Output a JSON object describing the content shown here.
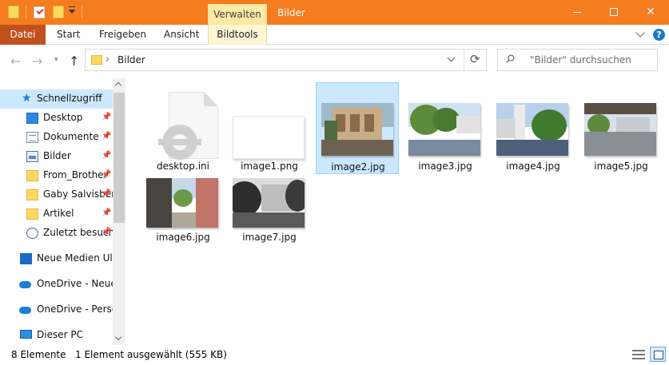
{
  "titlebar": {
    "contextual_tab": "Verwalten",
    "window_title": "Bilder",
    "accent": "#f57c1f"
  },
  "ribbon": {
    "file": "Datei",
    "start": "Start",
    "share": "Freigeben",
    "view": "Ansicht",
    "tools": "Bildtools",
    "file_color": "#c0501c"
  },
  "address": {
    "path": "Bilder",
    "search_placeholder": "\"Bilder\" durchsuchen"
  },
  "navpane": {
    "items": [
      {
        "label": "Schnellzugriff",
        "icon": "star-icon"
      },
      {
        "label": "Desktop",
        "icon": "desktop-icon",
        "pinned": true
      },
      {
        "label": "Dokumente",
        "icon": "documents-icon",
        "pinned": true
      },
      {
        "label": "Bilder",
        "icon": "pictures-icon",
        "pinned": true
      },
      {
        "label": "From_Brother",
        "icon": "folder-icon",
        "pinned": true
      },
      {
        "label": "Gaby Salvisberg",
        "icon": "folder-icon",
        "pinned": true
      },
      {
        "label": "Artikel",
        "icon": "folder-icon",
        "pinned": true
      },
      {
        "label": "Zuletzt besucht",
        "icon": "recent-icon",
        "pinned": true
      },
      {
        "label": "Neue Medien Ulm",
        "icon": "building-icon"
      },
      {
        "label": "OneDrive - Neue Medien",
        "icon": "onedrive-icon"
      },
      {
        "label": "OneDrive - Personal",
        "icon": "onedrive-icon"
      },
      {
        "label": "Dieser PC",
        "icon": "pc-icon"
      }
    ],
    "pin_glyph": "📌"
  },
  "files": [
    {
      "name": "desktop.ini",
      "type": "ini"
    },
    {
      "name": "image1.png",
      "type": "blank"
    },
    {
      "name": "image2.jpg",
      "type": "photo",
      "selected": true
    },
    {
      "name": "image3.jpg",
      "type": "photo"
    },
    {
      "name": "image4.jpg",
      "type": "photo"
    },
    {
      "name": "image5.jpg",
      "type": "photo"
    },
    {
      "name": "image6.jpg",
      "type": "photo"
    },
    {
      "name": "image7.jpg",
      "type": "photo"
    }
  ],
  "status": {
    "count": "8 Elemente",
    "selection": "1 Element ausgewählt (555 KB)"
  }
}
